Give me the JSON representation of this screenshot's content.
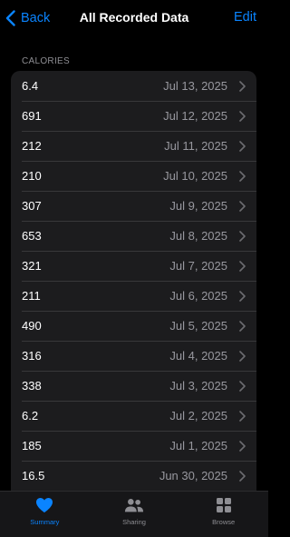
{
  "nav": {
    "back_label": "Back",
    "title": "All Recorded Data",
    "edit_label": "Edit"
  },
  "section": {
    "header": "CALORIES"
  },
  "rows": [
    {
      "value": "6.4",
      "date": "Jul 13, 2025"
    },
    {
      "value": "691",
      "date": "Jul 12, 2025"
    },
    {
      "value": "212",
      "date": "Jul 11, 2025"
    },
    {
      "value": "210",
      "date": "Jul 10, 2025"
    },
    {
      "value": "307",
      "date": "Jul 9, 2025"
    },
    {
      "value": "653",
      "date": "Jul 8, 2025"
    },
    {
      "value": "321",
      "date": "Jul 7, 2025"
    },
    {
      "value": "211",
      "date": "Jul 6, 2025"
    },
    {
      "value": "490",
      "date": "Jul 5, 2025"
    },
    {
      "value": "316",
      "date": "Jul 4, 2025"
    },
    {
      "value": "338",
      "date": "Jul 3, 2025"
    },
    {
      "value": "6.2",
      "date": "Jul 2, 2025"
    },
    {
      "value": "185",
      "date": "Jul 1, 2025"
    },
    {
      "value": "16.5",
      "date": "Jun 30, 2025"
    }
  ],
  "tabbar": {
    "tabs": [
      {
        "label": "Summary",
        "icon": "heart-icon",
        "active": true
      },
      {
        "label": "Sharing",
        "icon": "people-icon",
        "active": false
      },
      {
        "label": "Browse",
        "icon": "grid-icon",
        "active": false
      }
    ]
  },
  "colors": {
    "accent": "#0a84ff",
    "background": "#000000",
    "list_background": "#1c1c1e",
    "secondary_text": "#98989f"
  }
}
